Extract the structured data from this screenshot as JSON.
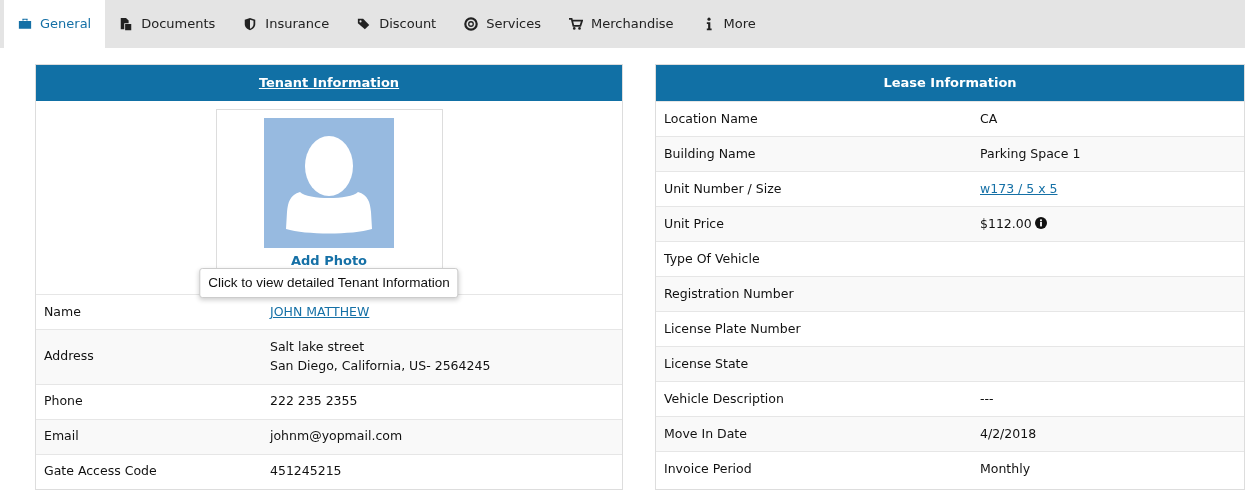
{
  "tabs": [
    {
      "label": "General",
      "selected": true
    },
    {
      "label": "Documents",
      "selected": false
    },
    {
      "label": "Insurance",
      "selected": false
    },
    {
      "label": "Discount",
      "selected": false
    },
    {
      "label": "Services",
      "selected": false
    },
    {
      "label": "Merchandise",
      "selected": false
    },
    {
      "label": "More",
      "selected": false
    }
  ],
  "tenant_panel": {
    "title": "Tenant Information",
    "title_link": true,
    "photo_action": "Add Photo",
    "tooltip": "Click to view detailed Tenant Information",
    "rows": [
      {
        "label": "Name",
        "value": "JOHN MATTHEW",
        "link": true
      },
      {
        "label": "Address",
        "lines": [
          "Salt lake street",
          "San Diego, California, US- 2564245"
        ]
      },
      {
        "label": "Phone",
        "value": "222 235 2355"
      },
      {
        "label": "Email",
        "value": "johnm@yopmail.com"
      },
      {
        "label": "Gate Access Code",
        "value": "451245215"
      }
    ]
  },
  "lease_panel": {
    "title": "Lease Information",
    "title_link": false,
    "rows": [
      {
        "label": "Location Name",
        "value": "CA"
      },
      {
        "label": "Building Name",
        "value": "Parking Space 1"
      },
      {
        "label": "Unit Number / Size",
        "value": "w173 / 5 x 5",
        "link": true
      },
      {
        "label": "Unit Price",
        "value": "$112.00",
        "info": true
      },
      {
        "label": "Type Of Vehicle"
      },
      {
        "label": "Registration Number"
      },
      {
        "label": "License Plate Number"
      },
      {
        "label": "License State"
      },
      {
        "label": "Vehicle Description",
        "value": "---"
      },
      {
        "label": "Move In Date",
        "value": "4/2/2018"
      },
      {
        "label": "Invoice Period",
        "value": "Monthly"
      }
    ]
  }
}
